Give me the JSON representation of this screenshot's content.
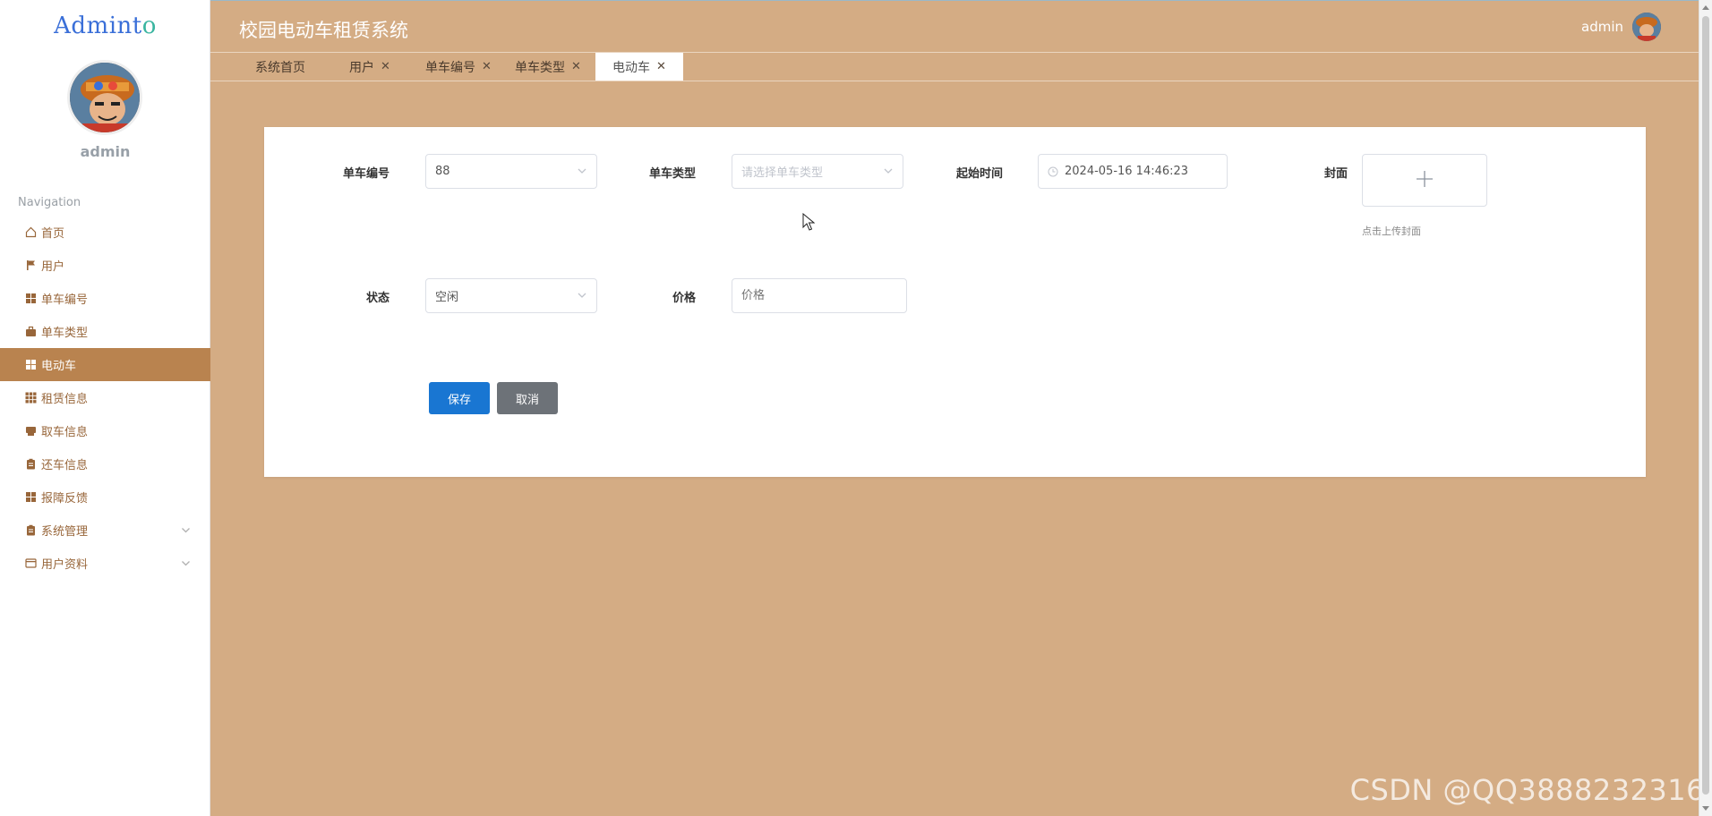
{
  "brand": {
    "logo_main": "Admint",
    "logo_tail": "o"
  },
  "sidebar": {
    "user_name": "admin",
    "nav_title": "Navigation",
    "items": [
      {
        "label": "首页",
        "icon": "home-icon"
      },
      {
        "label": "用户",
        "icon": "flag-icon"
      },
      {
        "label": "单车编号",
        "icon": "grid-icon"
      },
      {
        "label": "单车类型",
        "icon": "briefcase-icon"
      },
      {
        "label": "电动车",
        "icon": "grid-icon",
        "active": true
      },
      {
        "label": "租赁信息",
        "icon": "grid9-icon"
      },
      {
        "label": "取车信息",
        "icon": "printer-icon"
      },
      {
        "label": "还车信息",
        "icon": "clipboard-icon"
      },
      {
        "label": "报障反馈",
        "icon": "grid-icon"
      },
      {
        "label": "系统管理",
        "icon": "clipboard-icon",
        "expandable": true
      },
      {
        "label": "用户资料",
        "icon": "card-icon",
        "expandable": true
      }
    ]
  },
  "header": {
    "title": "校园电动车租赁系统",
    "user": "admin"
  },
  "tabs": [
    {
      "label": "系统首页",
      "closable": false
    },
    {
      "label": "用户",
      "closable": true
    },
    {
      "label": "单车编号",
      "closable": true
    },
    {
      "label": "单车类型",
      "closable": true
    },
    {
      "label": "电动车",
      "closable": true,
      "active": true
    }
  ],
  "form": {
    "bike_number": {
      "label": "单车编号",
      "value": "88"
    },
    "bike_type": {
      "label": "单车类型",
      "placeholder": "请选择单车类型"
    },
    "start_time": {
      "label": "起始时间",
      "value": "2024-05-16 14:46:23"
    },
    "cover": {
      "label": "封面",
      "tip": "点击上传封面"
    },
    "status": {
      "label": "状态",
      "value": "空闲"
    },
    "price": {
      "label": "价格",
      "placeholder": "价格"
    },
    "save_label": "保存",
    "cancel_label": "取消"
  },
  "watermark": "CSDN @QQ3888232316",
  "colors": {
    "theme": "#d4ac84",
    "sidebar_active": "#b9834f",
    "primary_button": "#1976d2",
    "secondary_button": "#6d7278",
    "menu_text": "#98663a"
  }
}
